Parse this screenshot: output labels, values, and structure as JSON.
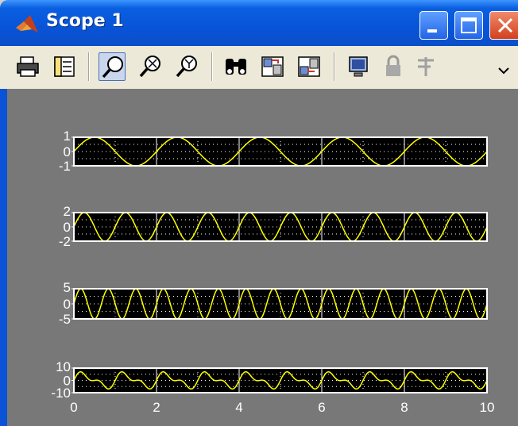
{
  "window": {
    "title": "Scope 1",
    "icon": "matlab-logo-icon",
    "controls": [
      "minimize-icon",
      "maximize-icon",
      "close-icon"
    ]
  },
  "toolbar": {
    "buttons": [
      {
        "name": "print-button",
        "icon": "printer-icon"
      },
      {
        "name": "parameters-button",
        "icon": "parameters-icon"
      },
      {
        "name": "zoom-button",
        "icon": "zoom-icon",
        "active": true
      },
      {
        "name": "zoom-x-button",
        "icon": "zoom-x-icon"
      },
      {
        "name": "zoom-y-button",
        "icon": "zoom-y-icon"
      },
      {
        "name": "autoscale-button",
        "icon": "binoculars-icon"
      },
      {
        "name": "save-axes-button",
        "icon": "save-axes-icon"
      },
      {
        "name": "restore-axes-button",
        "icon": "restore-axes-icon"
      },
      {
        "name": "floating-scope-button",
        "icon": "monitor-icon"
      },
      {
        "name": "lock-axes-button",
        "icon": "lock-icon"
      },
      {
        "name": "signal-selection-button",
        "icon": "signal-selection-icon"
      },
      {
        "name": "toolbar-overflow-button",
        "icon": "chevron-icon"
      }
    ]
  },
  "chart_data": [
    {
      "type": "line",
      "xlim": [
        0,
        10
      ],
      "ylim": [
        -1,
        1
      ],
      "yticks": [
        "1",
        "0",
        "-1"
      ],
      "grid": true,
      "line_color": "#ffff00",
      "series": [
        {
          "function": "sin",
          "amplitude": 1,
          "frequency_hz": 0.5,
          "phase_rad": 0
        }
      ]
    },
    {
      "type": "line",
      "xlim": [
        0,
        10
      ],
      "ylim": [
        -2,
        2
      ],
      "yticks": [
        "2",
        "0",
        "-2"
      ],
      "grid": true,
      "line_color": "#ffff00",
      "series": [
        {
          "function": "sin",
          "amplitude": 2,
          "frequency_hz": 1,
          "phase_rad": 0
        }
      ]
    },
    {
      "type": "line",
      "xlim": [
        0,
        10
      ],
      "ylim": [
        -5,
        5
      ],
      "yticks": [
        "5",
        "0",
        "-5"
      ],
      "grid": true,
      "line_color": "#ffff00",
      "series": [
        {
          "function": "sin",
          "amplitude": 5,
          "frequency_hz": 1.5,
          "phase_rad": 0
        }
      ]
    },
    {
      "type": "line",
      "xlim": [
        0,
        10
      ],
      "ylim": [
        -10,
        10
      ],
      "yticks": [
        "10",
        "0",
        "-10"
      ],
      "xticks": [
        "0",
        "2",
        "4",
        "6",
        "8",
        "10"
      ],
      "grid": true,
      "line_color": "#ffff00",
      "series": [
        {
          "function": "sum_of_sines",
          "components": [
            {
              "amplitude": 5,
              "frequency_hz": 1
            },
            {
              "amplitude": 3,
              "frequency_hz": 2
            }
          ]
        }
      ]
    }
  ],
  "colors": {
    "titlebar": "#0a5fe0",
    "toolbar": "#ece9d8",
    "scope_background": "#787878",
    "axes_background": "#000000",
    "axes_frame": "#ffffff",
    "trace": "#ffff00",
    "label_text": "#ffffff"
  }
}
